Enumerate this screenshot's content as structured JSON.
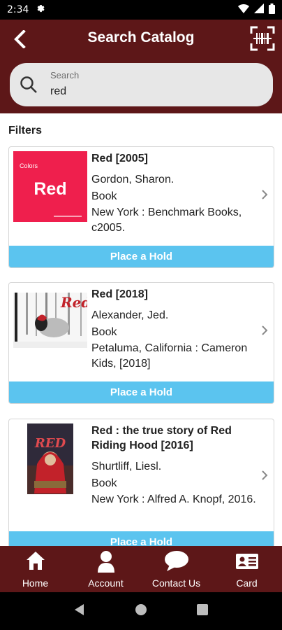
{
  "status": {
    "time": "2:34"
  },
  "header": {
    "title": "Search Catalog"
  },
  "search": {
    "label": "Search",
    "value": "red"
  },
  "filters_label": "Filters",
  "results": [
    {
      "title": "Red [2005]",
      "author": "Gordon, Sharon.",
      "format": "Book",
      "publisher": "New York : Benchmark Books, c2005.",
      "cover_title": "Red",
      "cover_series": "Colors",
      "hold_label": "Place a Hold"
    },
    {
      "title": "Red [2018]",
      "author": "Alexander, Jed.",
      "format": "Book",
      "publisher": "Petaluma, California : Cameron Kids, [2018]",
      "cover_title": "Red",
      "hold_label": "Place a Hold"
    },
    {
      "title": "Red : the true story of Red Riding Hood [2016]",
      "author": "Shurtliff, Liesl.",
      "format": "Book",
      "publisher": "New York : Alfred A. Knopf, 2016.",
      "cover_title": "RED",
      "hold_label": "Place a Hold"
    }
  ],
  "nav": [
    {
      "label": "Home",
      "icon": "home-icon"
    },
    {
      "label": "Account",
      "icon": "account-icon"
    },
    {
      "label": "Contact Us",
      "icon": "chat-icon"
    },
    {
      "label": "Card",
      "icon": "card-icon"
    }
  ],
  "colors": {
    "primary": "#5d1718",
    "accent": "#5bc4ef",
    "search_bg": "#e7e7e7"
  }
}
